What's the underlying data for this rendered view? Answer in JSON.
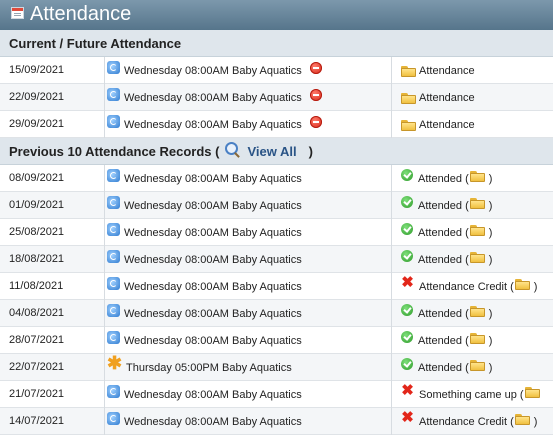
{
  "page": {
    "title": "Attendance"
  },
  "current": {
    "heading": "Current / Future Attendance",
    "rows": [
      {
        "date": "15/09/2021",
        "session": "Wednesday 08:00AM Baby Aquatics",
        "status": "Attendance"
      },
      {
        "date": "22/09/2021",
        "session": "Wednesday 08:00AM Baby Aquatics",
        "status": "Attendance"
      },
      {
        "date": "29/09/2021",
        "session": "Wednesday 08:00AM Baby Aquatics",
        "status": "Attendance"
      }
    ]
  },
  "previous": {
    "heading": "Previous 10 Attendance Records (",
    "view_all": "View All",
    "close_paren": ")",
    "rows": [
      {
        "date": "08/09/2021",
        "session": "Wednesday 08:00AM Baby Aquatics",
        "session_icon": "sync-icon",
        "status_icon": "check-icon",
        "status": "Attended (",
        "tail": ")"
      },
      {
        "date": "01/09/2021",
        "session": "Wednesday 08:00AM Baby Aquatics",
        "session_icon": "sync-icon",
        "status_icon": "check-icon",
        "status": "Attended (",
        "tail": ")"
      },
      {
        "date": "25/08/2021",
        "session": "Wednesday 08:00AM Baby Aquatics",
        "session_icon": "sync-icon",
        "status_icon": "check-icon",
        "status": "Attended (",
        "tail": ")"
      },
      {
        "date": "18/08/2021",
        "session": "Wednesday 08:00AM Baby Aquatics",
        "session_icon": "sync-icon",
        "status_icon": "check-icon",
        "status": "Attended (",
        "tail": ")"
      },
      {
        "date": "11/08/2021",
        "session": "Wednesday 08:00AM Baby Aquatics",
        "session_icon": "sync-icon",
        "status_icon": "cross-icon",
        "status": "Attendance Credit (",
        "tail": ")"
      },
      {
        "date": "04/08/2021",
        "session": "Wednesday 08:00AM Baby Aquatics",
        "session_icon": "sync-icon",
        "status_icon": "check-icon",
        "status": "Attended (",
        "tail": ")"
      },
      {
        "date": "28/07/2021",
        "session": "Wednesday 08:00AM Baby Aquatics",
        "session_icon": "sync-icon",
        "status_icon": "check-icon",
        "status": "Attended (",
        "tail": ")"
      },
      {
        "date": "22/07/2021",
        "session": "Thursday 05:00PM Baby Aquatics",
        "session_icon": "star-icon",
        "status_icon": "check-icon",
        "status": "Attended (",
        "tail": ")"
      },
      {
        "date": "21/07/2021",
        "session": "Wednesday 08:00AM Baby Aquatics",
        "session_icon": "sync-icon",
        "status_icon": "cross-icon",
        "status": "Something came up (",
        "tail": ""
      },
      {
        "date": "14/07/2021",
        "session": "Wednesday 08:00AM Baby Aquatics",
        "session_icon": "sync-icon",
        "status_icon": "cross-icon",
        "status": "Attendance Credit (",
        "tail": ")"
      }
    ]
  },
  "colors": {
    "header_bg": "#5f7d92",
    "section_bg": "#dfe6ec",
    "link": "#2a5486",
    "cancel_red": "#d62414",
    "check_green": "#2e9a2a"
  }
}
